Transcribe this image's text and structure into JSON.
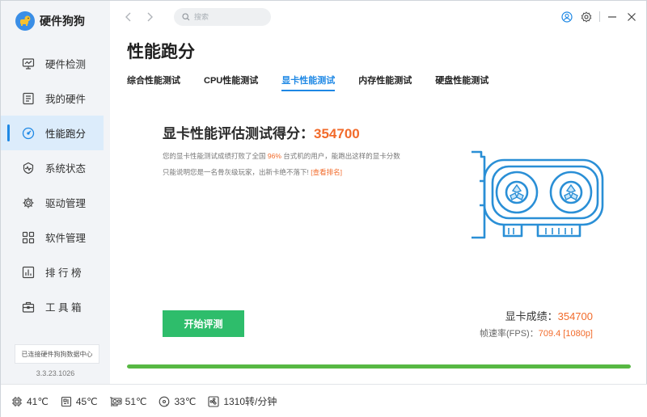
{
  "app": {
    "name": "硬件狗狗",
    "version": "3.3.23.1026",
    "connection_status": "已连接硬件狗狗数据中心"
  },
  "sidebar": {
    "items": [
      {
        "label": "硬件检测",
        "icon": "monitor-icon"
      },
      {
        "label": "我的硬件",
        "icon": "list-icon"
      },
      {
        "label": "性能跑分",
        "icon": "speedometer-icon",
        "active": true
      },
      {
        "label": "系统状态",
        "icon": "shield-icon"
      },
      {
        "label": "驱动管理",
        "icon": "gear-icon"
      },
      {
        "label": "软件管理",
        "icon": "apps-icon"
      },
      {
        "label": "排 行 榜",
        "icon": "chart-icon"
      },
      {
        "label": "工 具 箱",
        "icon": "toolbox-icon"
      }
    ]
  },
  "search": {
    "placeholder": "搜索"
  },
  "page": {
    "title": "性能跑分",
    "tabs": [
      {
        "label": "综合性能测试"
      },
      {
        "label": "CPU性能测试"
      },
      {
        "label": "显卡性能测试",
        "active": true
      },
      {
        "label": "内存性能测试"
      },
      {
        "label": "硬盘性能测试"
      }
    ]
  },
  "score": {
    "title_prefix": "显卡性能评估测试得分：",
    "value": "354700",
    "desc_part1": "您的显卡性能测试成绩打败了全国 ",
    "desc_percent": "96%",
    "desc_part2": " 台式机的用户，能跑出这样的显卡分数只能说明您是一名骨灰级玩家，出新卡绝不落下!  ",
    "desc_link": "[查看排名]"
  },
  "actions": {
    "start_label": "开始评测"
  },
  "result": {
    "score_label": "显卡成绩：",
    "score_value": "354700",
    "fps_label": "帧速率(FPS)：",
    "fps_value": "709.4 [1080p]"
  },
  "progress": {
    "value": 1.0,
    "color": "#57b843"
  },
  "status_bar": [
    {
      "icon": "cpu-icon",
      "text": "41℃"
    },
    {
      "icon": "motherboard-icon",
      "text": "45℃"
    },
    {
      "icon": "gpu-icon",
      "text": "51℃"
    },
    {
      "icon": "disk-icon",
      "text": "33℃"
    },
    {
      "icon": "fan-icon",
      "text": "1310转/分钟"
    }
  ],
  "colors": {
    "accent": "#1e88e5",
    "highlight": "#f26b2b",
    "start_button": "#2ebd6b",
    "illustration": "#2a8fd6"
  }
}
